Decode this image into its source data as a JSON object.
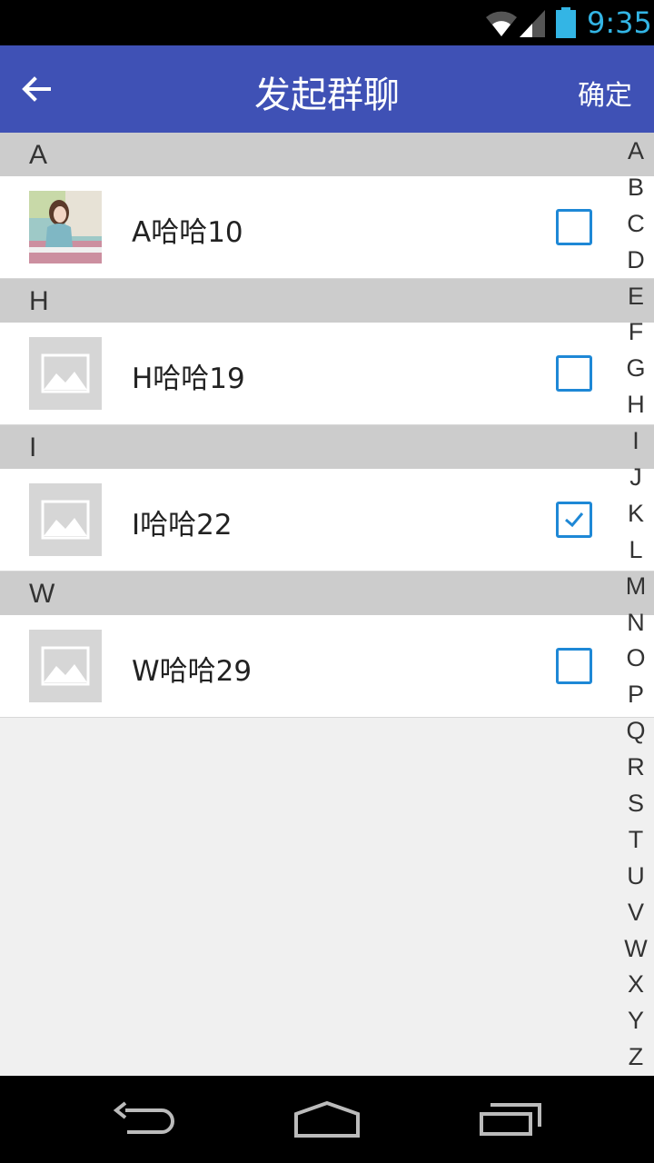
{
  "status_bar": {
    "time": "9:35",
    "accent_color": "#33b5e5",
    "icons": [
      "wifi-icon",
      "signal-icon",
      "battery-icon"
    ]
  },
  "app_bar": {
    "title": "发起群聊",
    "confirm_label": "确定",
    "back_icon": "back-arrow-icon",
    "color": "#3f51b5"
  },
  "sections": [
    {
      "letter": "A",
      "contacts": [
        {
          "name": "A哈哈10",
          "checked": false,
          "avatar": "photo"
        }
      ]
    },
    {
      "letter": "H",
      "contacts": [
        {
          "name": "H哈哈19",
          "checked": false,
          "avatar": "placeholder"
        }
      ]
    },
    {
      "letter": "I",
      "contacts": [
        {
          "name": "I哈哈22",
          "checked": true,
          "avatar": "placeholder"
        }
      ]
    },
    {
      "letter": "W",
      "contacts": [
        {
          "name": "W哈哈29",
          "checked": false,
          "avatar": "placeholder"
        }
      ]
    }
  ],
  "index_letters": [
    "A",
    "B",
    "C",
    "D",
    "E",
    "F",
    "G",
    "H",
    "I",
    "J",
    "K",
    "L",
    "M",
    "N",
    "O",
    "P",
    "Q",
    "R",
    "S",
    "T",
    "U",
    "V",
    "W",
    "X",
    "Y",
    "Z"
  ],
  "nav_bar": {
    "icons": [
      "back-nav-icon",
      "home-nav-icon",
      "recents-nav-icon"
    ]
  },
  "checkbox_color": "#1e88d6"
}
